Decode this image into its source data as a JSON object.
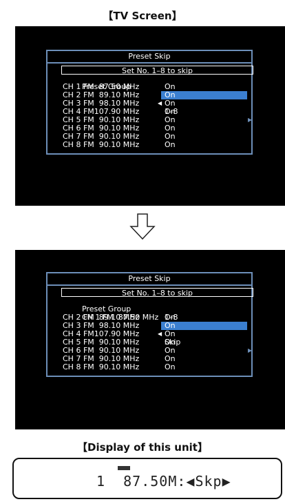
{
  "headings": {
    "tv": "【TV Screen】",
    "unit": "【Display of this unit】"
  },
  "menu_before": {
    "title": "Preset Skip",
    "hint": "Set No. 1–8 to skip",
    "group_label": "Preset Group",
    "group_value": "1–8",
    "rows": [
      {
        "label": "CH 1 FM  87.50 MHz",
        "value": "On"
      },
      {
        "label": "CH 2 FM  89.10 MHz",
        "value": "On"
      },
      {
        "label": "CH 3 FM  98.10 MHz",
        "value": "On"
      },
      {
        "label": "CH 4 FM107.90 MHz",
        "value": "On"
      },
      {
        "label": "CH 5 FM  90.10 MHz",
        "value": "On"
      },
      {
        "label": "CH 6 FM  90.10 MHz",
        "value": "On"
      },
      {
        "label": "CH 7 FM  90.10 MHz",
        "value": "On"
      },
      {
        "label": "CH 8 FM  90.10 MHz",
        "value": "On"
      }
    ]
  },
  "menu_after": {
    "title": "Preset Skip",
    "hint": "Set No. 1–8 to skip",
    "group_label": "Preset Group",
    "group_value": "1–8",
    "rows": [
      {
        "label": "CH 1 FM  87.50 MHz",
        "value": "Skip"
      },
      {
        "label": "CH 2 FM  89.10 MHz",
        "value": "On"
      },
      {
        "label": "CH 3 FM  98.10 MHz",
        "value": "On"
      },
      {
        "label": "CH 4 FM107.90 MHz",
        "value": "On"
      },
      {
        "label": "CH 5 FM  90.10 MHz",
        "value": "On"
      },
      {
        "label": "CH 6 FM  90.10 MHz",
        "value": "On"
      },
      {
        "label": "CH 7 FM  90.10 MHz",
        "value": "On"
      },
      {
        "label": "CH 8 FM  90.10 MHz",
        "value": "On"
      }
    ]
  },
  "unit_display": {
    "text": "1  87.50M:◀Skp▶"
  },
  "colors": {
    "menu_border": "#6d8fb9",
    "highlight": "#3b7fd0",
    "screen": "#000000"
  },
  "icons": {
    "down_arrow": "down-arrow-icon"
  }
}
